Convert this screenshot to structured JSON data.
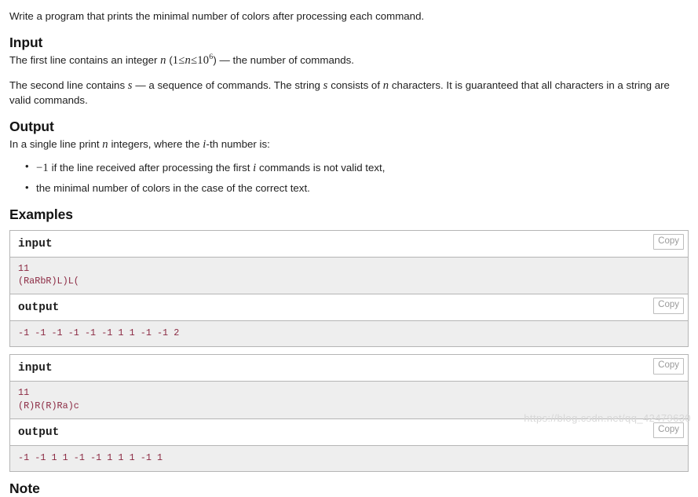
{
  "statement": {
    "intro": "Write a program that prints the minimal number of colors after processing each command.",
    "input_heading": "Input",
    "input_p1_a": "The first line contains an integer ",
    "input_p1_math_n": "n",
    "input_p1_b": " (",
    "input_p1_math_range_1": "1",
    "input_p1_math_le_1": "≤",
    "input_p1_math_n2": "n",
    "input_p1_math_le_2": "≤",
    "input_p1_math_pow_base": "10",
    "input_p1_math_pow_exp": "6",
    "input_p1_c": ") — the number of commands.",
    "input_p2_a": "The second line contains ",
    "input_p2_math_s1": "s",
    "input_p2_b": " — a sequence of commands. The string ",
    "input_p2_math_s2": "s",
    "input_p2_c": " consists of ",
    "input_p2_math_n": "n",
    "input_p2_d": " characters. It is guaranteed that all characters in a string are valid commands.",
    "output_heading": "Output",
    "output_p1_a": "In a single line print ",
    "output_p1_math_n": "n",
    "output_p1_b": " integers, where the ",
    "output_p1_math_i": "i",
    "output_p1_c": "-th number is:",
    "bullets": [
      {
        "math_prefix": "−1",
        "text": " if the line received after processing the first ",
        "math_mid": "i",
        "text2": " commands is not valid text,"
      },
      {
        "math_prefix": "",
        "text": "the minimal number of colors in the case of the correct text.",
        "math_mid": "",
        "text2": ""
      }
    ],
    "examples_heading": "Examples",
    "note_heading": "Note"
  },
  "examples": [
    {
      "input_label": "input",
      "input_copy_label": "Copy",
      "input_data": "11\n(RaRbR)L)L(",
      "output_label": "output",
      "output_copy_label": "Copy",
      "output_data": "-1 -1 -1 -1 -1 -1 1 1 -1 -1 2"
    },
    {
      "input_label": "input",
      "input_copy_label": "Copy",
      "input_data": "11\n(R)R(R)Ra)c",
      "output_label": "output",
      "output_copy_label": "Copy",
      "output_data": "-1 -1 1 1 -1 -1 1 1 1 -1 1"
    }
  ],
  "watermark": {
    "text": "https://blog.csdn.net/qq_42479630"
  },
  "colors": {
    "code_text": "#8b2942",
    "code_bg": "#eeeeee",
    "border": "#b5b5b5",
    "body_text": "#1f1f1f",
    "copy_text": "#9a9a9a"
  }
}
